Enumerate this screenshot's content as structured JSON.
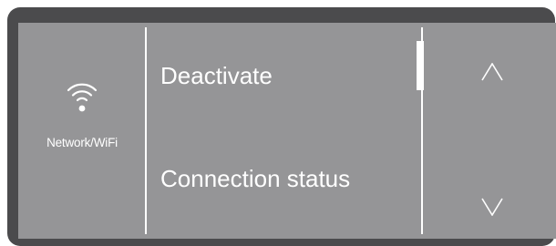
{
  "panel": {
    "category_label": "Network/WiFi",
    "icon": "wifi-icon"
  },
  "menu": {
    "items": [
      {
        "label": "Deactivate"
      },
      {
        "label": "Connection status"
      }
    ]
  },
  "scroll": {
    "up_icon": "chevron-up-icon",
    "down_icon": "chevron-down-icon"
  },
  "colors": {
    "bezel": "#4b4b4d",
    "screen": "#959597",
    "foreground": "#ffffff"
  }
}
